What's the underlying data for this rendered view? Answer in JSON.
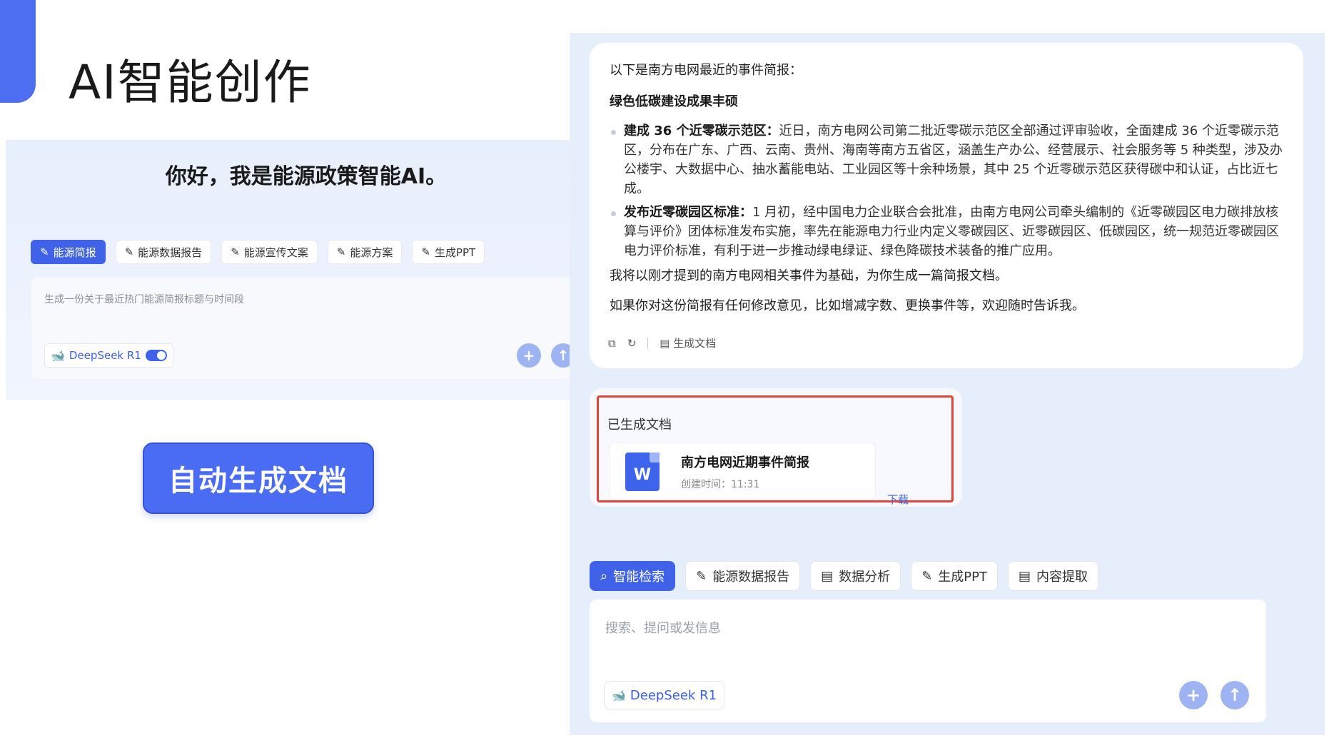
{
  "slide": {
    "title": "AI智能创作",
    "auto_button": "自动生成文档"
  },
  "left_chat": {
    "greeting": "你好，我是能源政策智能AI。",
    "chips": [
      {
        "label": "能源简报",
        "icon": "pencil-icon",
        "active": true
      },
      {
        "label": "能源数据报告",
        "icon": "pencil-icon",
        "active": false
      },
      {
        "label": "能源宣传文案",
        "icon": "pencil-icon",
        "active": false
      },
      {
        "label": "能源方案",
        "icon": "pencil-icon",
        "active": false
      },
      {
        "label": "生成PPT",
        "icon": "pencil-icon",
        "active": false
      }
    ],
    "input_text": "生成一份关于最近热门能源简报标题与时间段",
    "model": "DeepSeek R1"
  },
  "right_chat": {
    "intro": "以下是南方电网最近的事件简报：",
    "heading": "绿色低碳建设成果丰硕",
    "bullets": [
      {
        "title": "建成 36 个近零碳示范区：",
        "text": "近日，南方电网公司第二批近零碳示范区全部通过评审验收，全面建成 36 个近零碳示范区，分布在广东、广西、云南、贵州、海南等南方五省区，涵盖生产办公、经营展示、社会服务等 5 种类型，涉及办公楼宇、大数据中心、抽水蓄能电站、工业园区等十余种场景，其中 25 个近零碳示范区获得碳中和认证，占比近七成。"
      },
      {
        "title": "发布近零碳园区标准：",
        "text": "1 月初，经中国电力企业联合会批准，由南方电网公司牵头编制的《近零碳园区电力碳排放核算与评价》团体标准发布实施，率先在能源电力行业内定义零碳园区、近零碳园区、低碳园区，统一规范近零碳园区电力评价标准，有利于进一步推动绿电绿证、绿色降碳技术装备的推广应用。"
      }
    ],
    "para1": "我将以刚才提到的南方电网相关事件为基础，为你生成一篇简报文档。",
    "para2": "如果你对这份简报有任何修改意见，比如增减字数、更换事件等，欢迎随时告诉我。",
    "action_generate": "生成文档",
    "doc_section_label": "已生成文档",
    "doc": {
      "title": "南方电网近期事件简报",
      "time": "创建时间：11:31",
      "download": "下载",
      "icon_letter": "W"
    },
    "chips": [
      {
        "label": "智能检索",
        "icon": "search-icon",
        "active": true
      },
      {
        "label": "能源数据报告",
        "icon": "pencil-icon",
        "active": false
      },
      {
        "label": "数据分析",
        "icon": "chart-icon",
        "active": false
      },
      {
        "label": "生成PPT",
        "icon": "pencil-icon",
        "active": false
      },
      {
        "label": "内容提取",
        "icon": "document-icon",
        "active": false
      }
    ],
    "input_placeholder": "搜索、提问或发信息",
    "model": "DeepSeek R1"
  },
  "colors": {
    "accent": "#4e6ef2",
    "highlight_border": "#e0453a"
  }
}
